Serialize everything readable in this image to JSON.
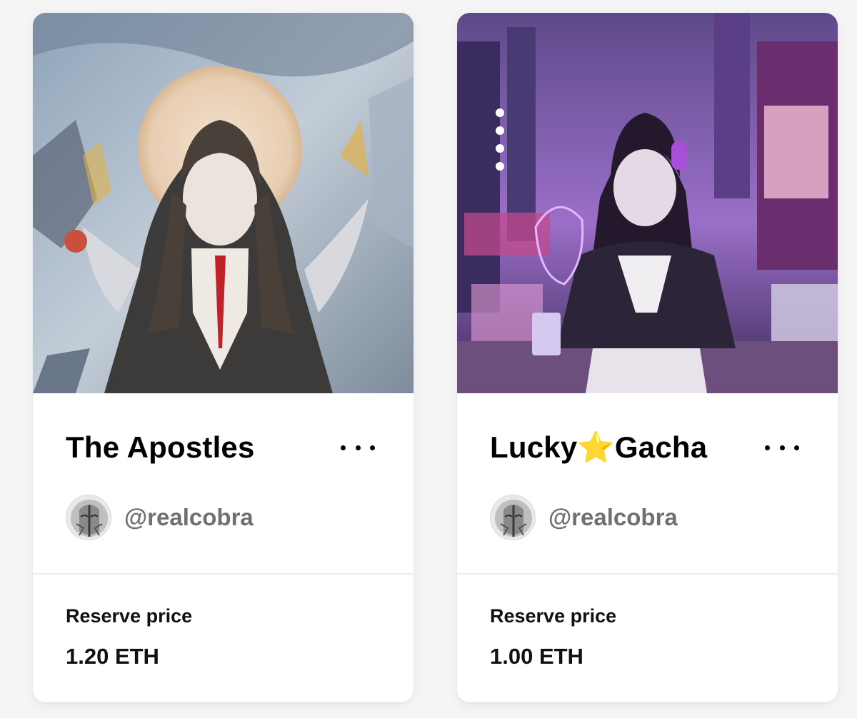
{
  "cards": [
    {
      "title": "The Apostles",
      "creator_handle": "@realcobra",
      "price_label": "Reserve price",
      "price_value": "1.20 ETH",
      "more_icon": "more-horizontal-icon"
    },
    {
      "title_parts": [
        "Lucky",
        "⭐",
        "Gacha"
      ],
      "creator_handle": "@realcobra",
      "price_label": "Reserve price",
      "price_value": "1.00 ETH",
      "more_icon": "more-horizontal-icon"
    }
  ],
  "colors": {
    "card_bg": "#ffffff",
    "page_bg": "#f5f5f5",
    "title": "#000000",
    "handle": "#707070",
    "divider": "#ececec",
    "star": "#f5b400"
  }
}
